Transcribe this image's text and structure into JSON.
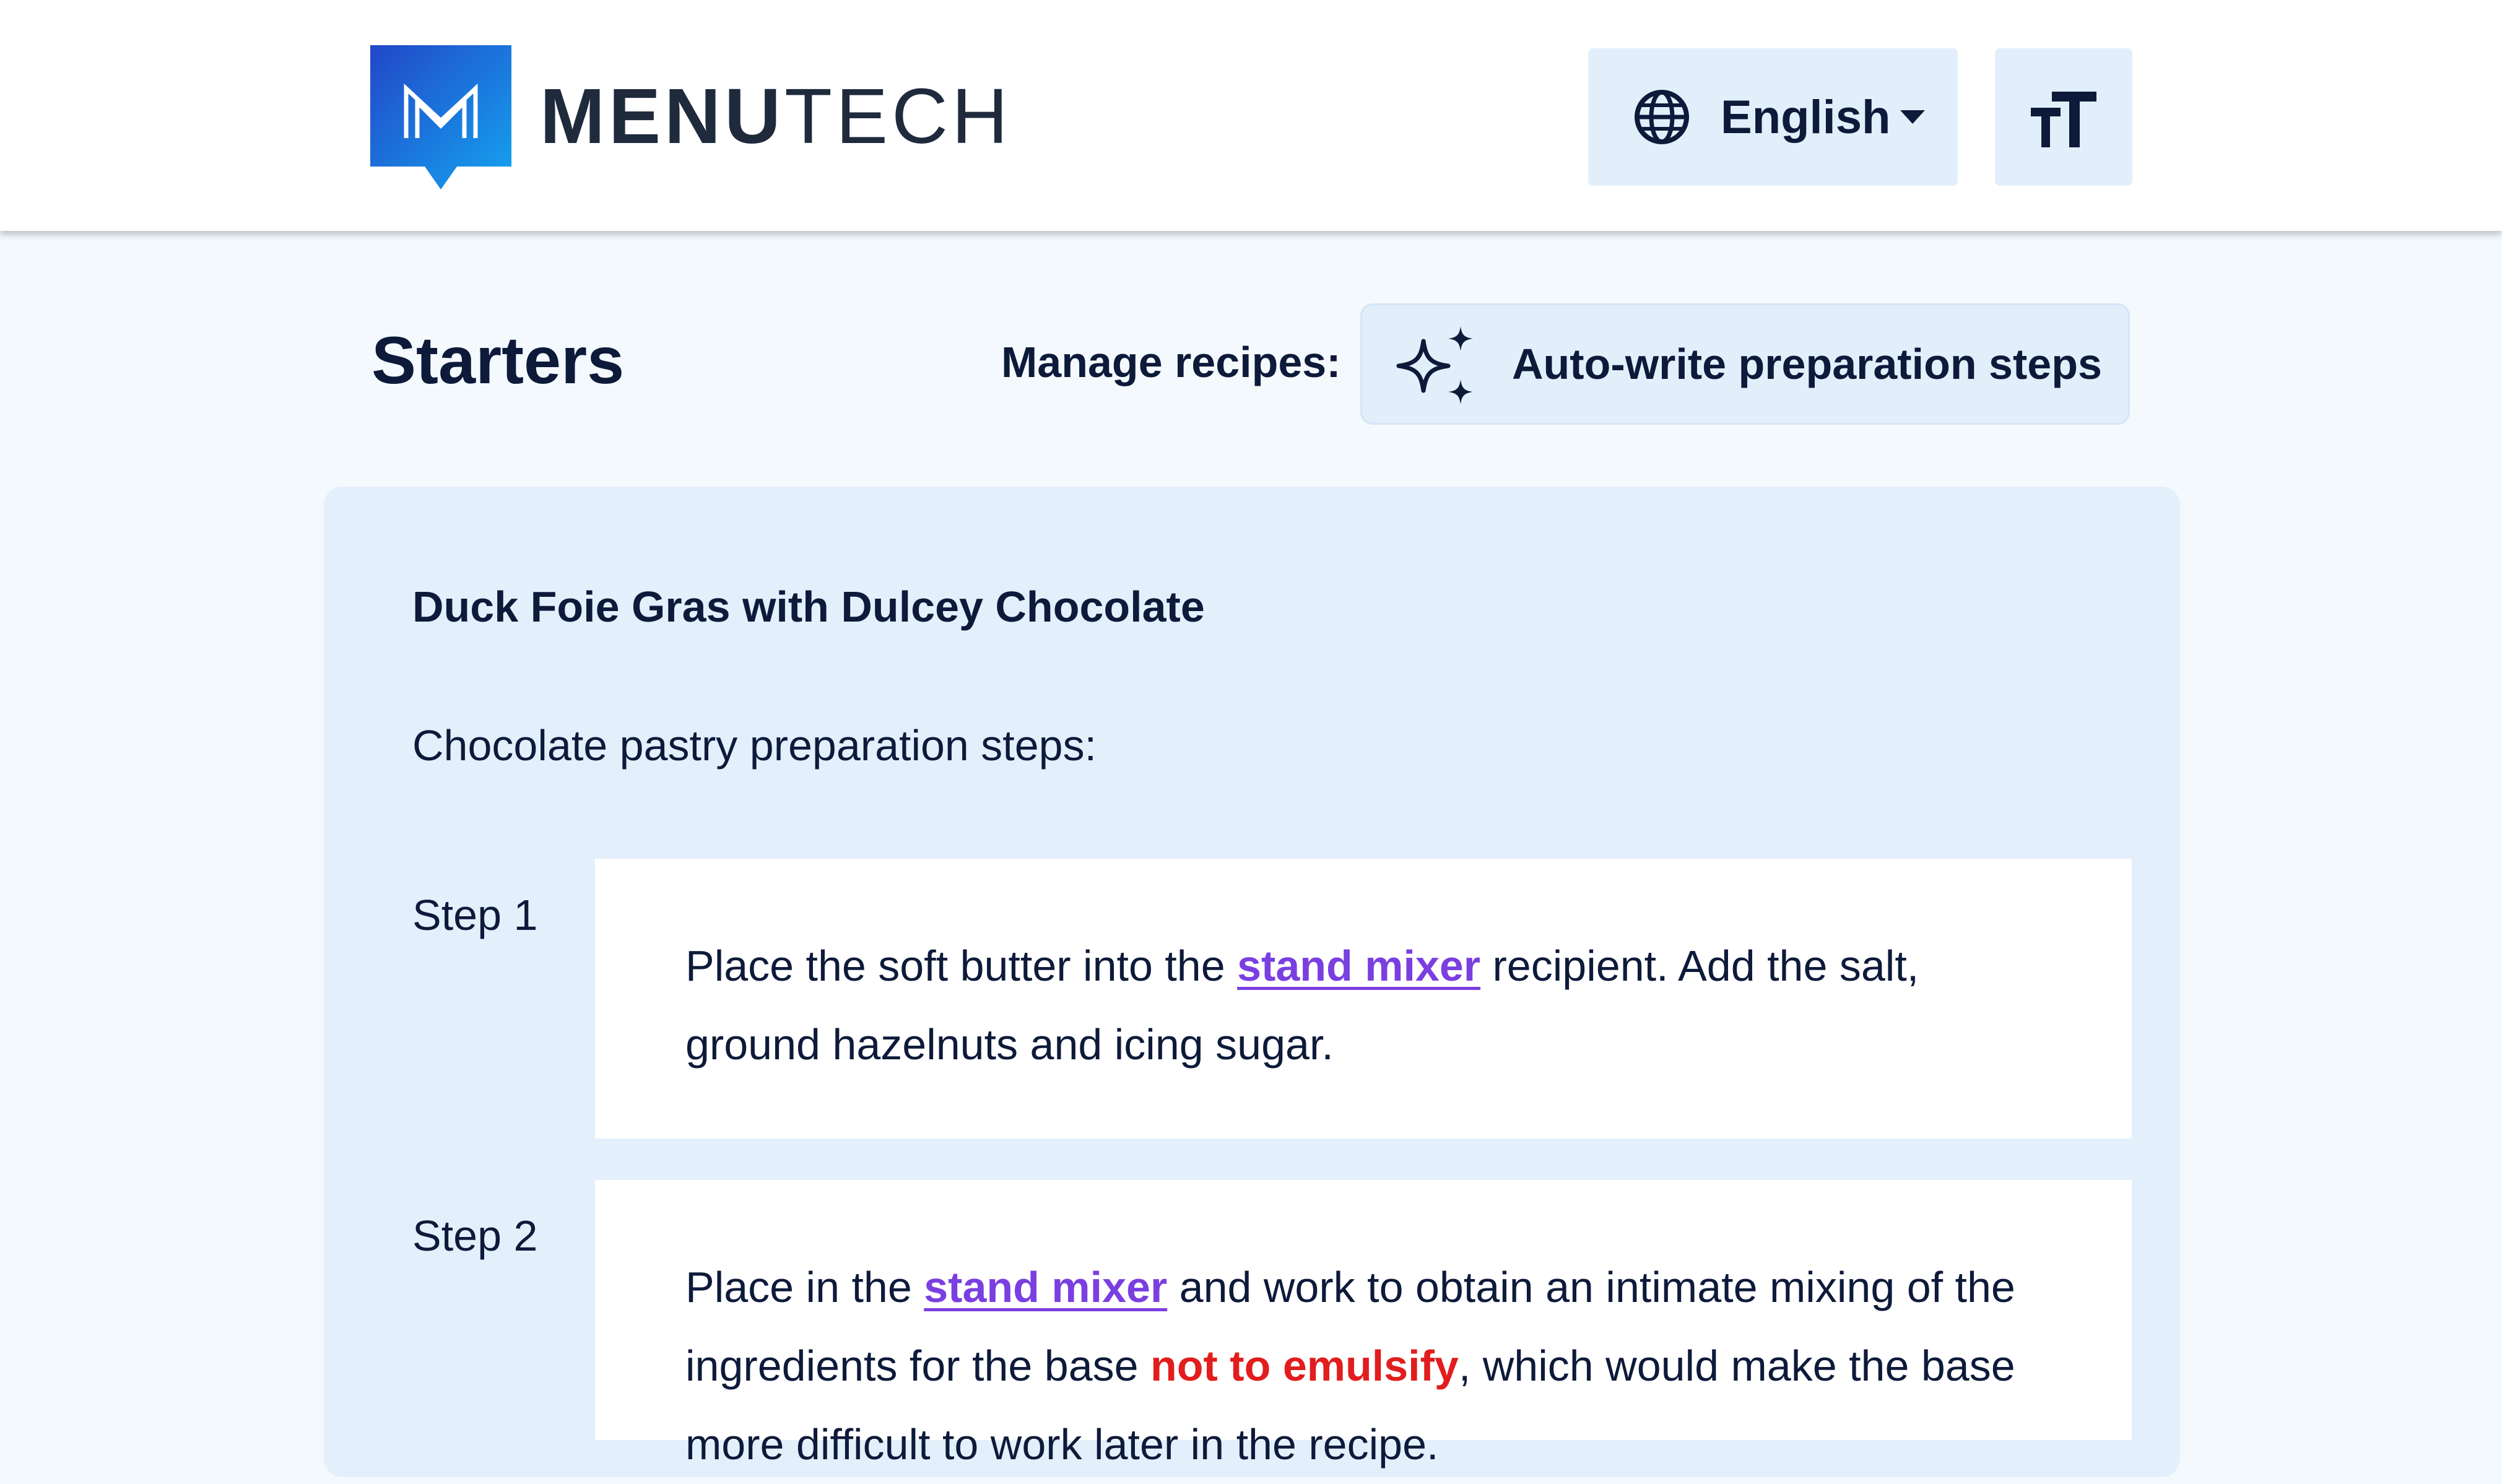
{
  "header": {
    "logo": {
      "icon": "menutech-logo-icon",
      "brand_bold": "MENU",
      "brand_light": "TECH"
    },
    "language": {
      "icon": "globe-icon",
      "value": "English",
      "caret_icon": "caret-down-icon"
    },
    "text_size": {
      "icon": "text-size-icon"
    }
  },
  "page": {
    "title": "Starters",
    "manage_label": "Manage recipes:",
    "auto_write": {
      "icon": "sparkles-icon",
      "label": "Auto-write preparation steps"
    }
  },
  "recipe": {
    "title": "Duck Foie Gras with Dulcey Chocolate",
    "section_label": "Chocolate pastry preparation steps:",
    "steps": [
      {
        "label": "Step 1",
        "text_a": "Place the soft butter into the ",
        "link": "stand mixer",
        "text_b": " recipient. Add the salt, ground hazelnuts and icing sugar."
      },
      {
        "label": "Step 2",
        "text_a": "Place in the ",
        "link": "stand mixer",
        "text_b": " and work to obtain an intimate mixing of the ingredients for the base ",
        "warning": "not to emulsify",
        "text_c": ", which would make the base more difficult to work later in the recipe."
      }
    ]
  },
  "colors": {
    "accent_link": "#7a3fe0",
    "warning": "#e21d1d",
    "button_bg": "#e2effb",
    "logo_blue": "#1f6fe0"
  }
}
